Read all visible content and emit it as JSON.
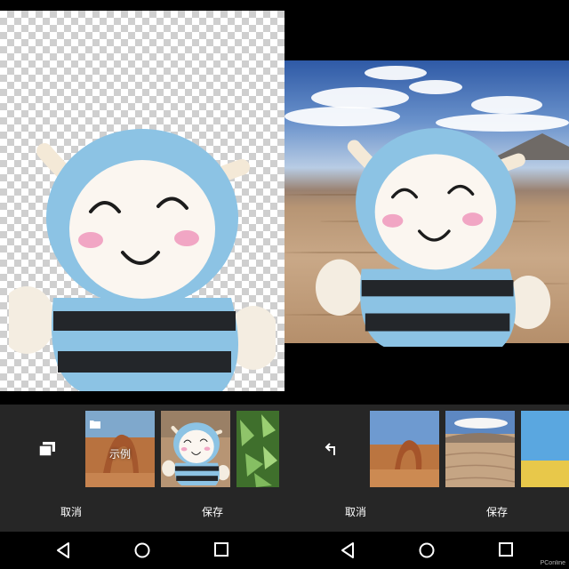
{
  "left": {
    "panel": {
      "left_icon": "photo-library-icon",
      "thumbnails": [
        {
          "name": "thumbnail-sample",
          "label": "示例",
          "icon": "folder-icon"
        },
        {
          "name": "thumbnail-plush-toy",
          "label": ""
        },
        {
          "name": "thumbnail-leaves",
          "label": ""
        }
      ],
      "cancel_label": "取消",
      "save_label": "保存"
    }
  },
  "right": {
    "panel": {
      "left_icon": "back-arrow-icon",
      "thumbnails": [
        {
          "name": "thumbnail-arch",
          "label": ""
        },
        {
          "name": "thumbnail-desert",
          "label": ""
        },
        {
          "name": "thumbnail-beach",
          "label": ""
        }
      ],
      "cancel_label": "取消",
      "save_label": "保存"
    }
  },
  "navbar": {
    "icons": [
      "back-triangle-icon",
      "home-circle-icon",
      "recents-square-icon"
    ]
  },
  "watermark": "PConline",
  "colors": {
    "panel_bg": "#262626",
    "toy_blue": "#8cc3e4",
    "cheek_pink": "#f1a6c4"
  }
}
